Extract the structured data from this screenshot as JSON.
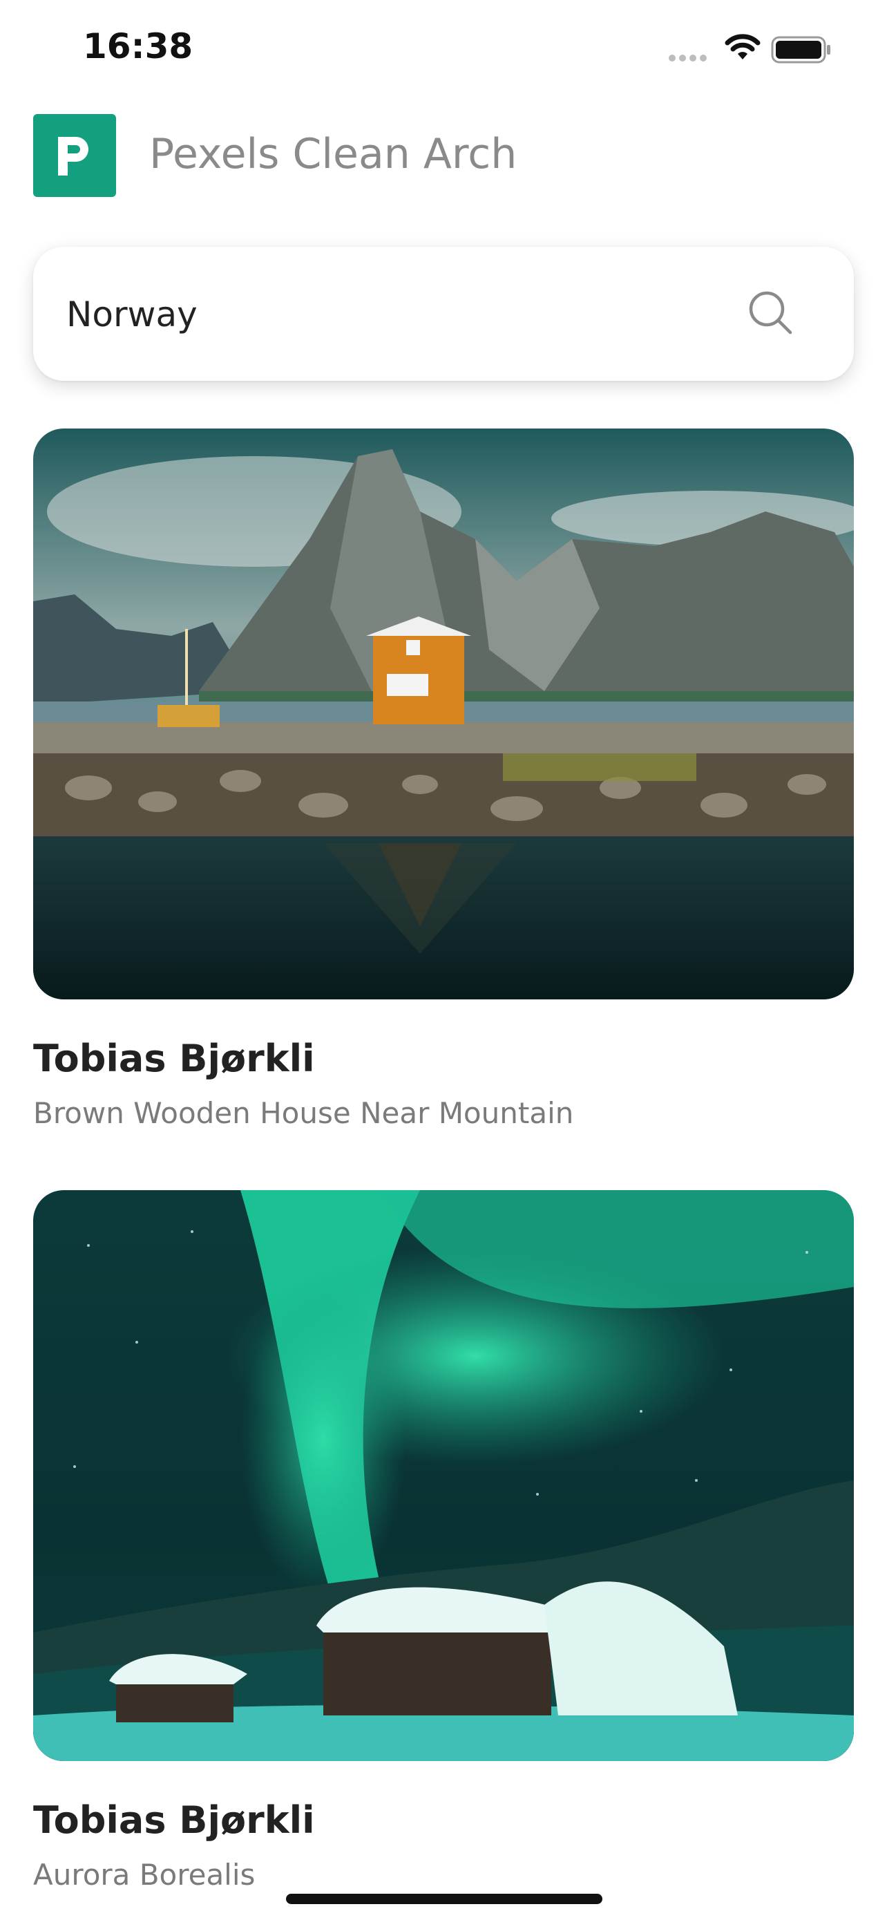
{
  "status_bar": {
    "time": "16:38",
    "icons": [
      "signal-icon",
      "wifi-icon",
      "battery-icon"
    ]
  },
  "header": {
    "logo_icon": "pexels-logo-icon",
    "title": "Pexels Clean Arch",
    "brand_color": "#13a07e"
  },
  "search": {
    "value": "Norway",
    "icon": "search-icon"
  },
  "photos": [
    {
      "photographer": "Tobias Bjørkli",
      "description": "Brown Wooden House Near Mountain"
    },
    {
      "photographer": "Tobias Bjørkli",
      "description": "Aurora Borealis"
    }
  ]
}
